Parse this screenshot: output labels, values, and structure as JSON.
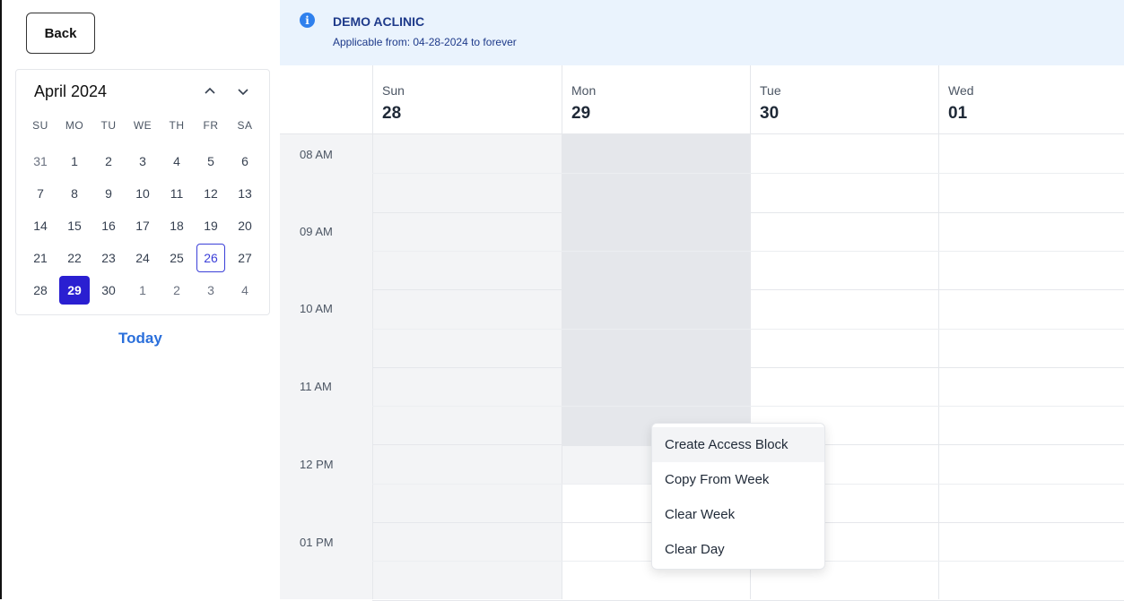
{
  "back_label": "Back",
  "calendar": {
    "month_label": "April 2024",
    "prev_icon": "chevron-up-icon",
    "next_icon": "chevron-down-icon",
    "weekdays": [
      "SU",
      "MO",
      "TU",
      "WE",
      "TH",
      "FR",
      "SA"
    ],
    "weeks": [
      [
        "31",
        "1",
        "2",
        "3",
        "4",
        "5",
        "6"
      ],
      [
        "7",
        "8",
        "9",
        "10",
        "11",
        "12",
        "13"
      ],
      [
        "14",
        "15",
        "16",
        "17",
        "18",
        "19",
        "20"
      ],
      [
        "21",
        "22",
        "23",
        "24",
        "25",
        "26",
        "27"
      ],
      [
        "28",
        "29",
        "30",
        "1",
        "2",
        "3",
        "4"
      ]
    ],
    "today_day": "26",
    "selected_day": "29",
    "today_label": "Today"
  },
  "banner": {
    "icon": "info-icon",
    "title": "DEMO ACLINIC",
    "subtitle": "Applicable from: 04-28-2024 to forever"
  },
  "days": [
    {
      "name": "Sun",
      "num": "28"
    },
    {
      "name": "Mon",
      "num": "29"
    },
    {
      "name": "Tue",
      "num": "30"
    },
    {
      "name": "Wed",
      "num": "01"
    }
  ],
  "times": [
    "08 AM",
    "09 AM",
    "10 AM",
    "11 AM",
    "12 PM",
    "01 PM"
  ],
  "context_menu": {
    "items": [
      "Create Access Block",
      "Copy From Week",
      "Clear Week",
      "Clear Day"
    ]
  },
  "colors": {
    "accent": "#2a1fd1",
    "banner_bg": "#eaf3fd",
    "link": "#2a6fdb"
  }
}
